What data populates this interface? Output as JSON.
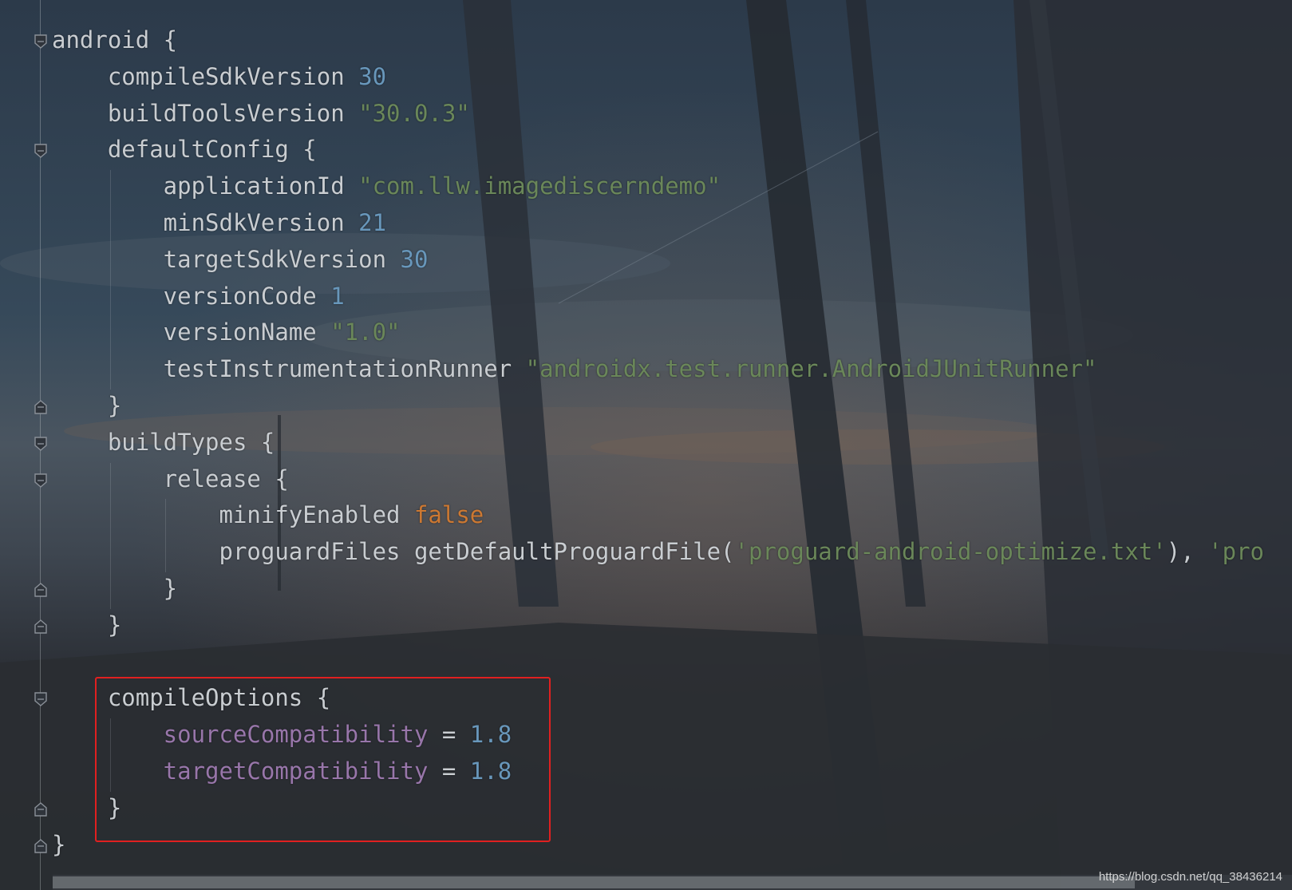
{
  "editor": {
    "language": "groovy",
    "lines": [
      [
        {
          "t": "android {",
          "c": "key"
        }
      ],
      [
        {
          "t": "    compileSdkVersion ",
          "c": "key"
        },
        {
          "t": "30",
          "c": "num"
        }
      ],
      [
        {
          "t": "    buildToolsVersion ",
          "c": "key"
        },
        {
          "t": "\"30.0.3\"",
          "c": "str"
        }
      ],
      [
        {
          "t": "    defaultConfig {",
          "c": "key"
        }
      ],
      [
        {
          "t": "        applicationId ",
          "c": "key"
        },
        {
          "t": "\"com.llw.imagediscerndemo\"",
          "c": "str"
        }
      ],
      [
        {
          "t": "        minSdkVersion ",
          "c": "key"
        },
        {
          "t": "21",
          "c": "num"
        }
      ],
      [
        {
          "t": "        targetSdkVersion ",
          "c": "key"
        },
        {
          "t": "30",
          "c": "num"
        }
      ],
      [
        {
          "t": "        versionCode ",
          "c": "key"
        },
        {
          "t": "1",
          "c": "num"
        }
      ],
      [
        {
          "t": "        versionName ",
          "c": "key"
        },
        {
          "t": "\"1.0\"",
          "c": "str"
        }
      ],
      [
        {
          "t": "        testInstrumentationRunner ",
          "c": "key"
        },
        {
          "t": "\"androidx.test.runner.AndroidJUnitRunner\"",
          "c": "str"
        }
      ],
      [
        {
          "t": "    }",
          "c": "key"
        }
      ],
      [
        {
          "t": "    buildTypes {",
          "c": "key"
        }
      ],
      [
        {
          "t": "        release {",
          "c": "key"
        }
      ],
      [
        {
          "t": "            minifyEnabled ",
          "c": "key"
        },
        {
          "t": "false",
          "c": "bool"
        }
      ],
      [
        {
          "t": "            proguardFiles getDefaultProguardFile(",
          "c": "key"
        },
        {
          "t": "'proguard-android-optimize.txt'",
          "c": "str"
        },
        {
          "t": "), ",
          "c": "key"
        },
        {
          "t": "'pro",
          "c": "str"
        }
      ],
      [
        {
          "t": "        }",
          "c": "key"
        }
      ],
      [
        {
          "t": "    }",
          "c": "key"
        }
      ],
      [],
      [
        {
          "t": "    compileOptions {",
          "c": "key"
        }
      ],
      [
        {
          "t": "        sourceCompatibility",
          "c": "prop"
        },
        {
          "t": " = ",
          "c": "key"
        },
        {
          "t": "1.8",
          "c": "num"
        }
      ],
      [
        {
          "t": "        targetCompatibility",
          "c": "prop"
        },
        {
          "t": " = ",
          "c": "key"
        },
        {
          "t": "1.8",
          "c": "num"
        }
      ],
      [
        {
          "t": "    }",
          "c": "key"
        }
      ],
      [
        {
          "t": "}",
          "c": "key"
        }
      ]
    ],
    "fold_markers": [
      {
        "line": 0,
        "kind": "open"
      },
      {
        "line": 3,
        "kind": "open"
      },
      {
        "line": 10,
        "kind": "close"
      },
      {
        "line": 11,
        "kind": "open"
      },
      {
        "line": 12,
        "kind": "open"
      },
      {
        "line": 15,
        "kind": "close"
      },
      {
        "line": 16,
        "kind": "close"
      },
      {
        "line": 18,
        "kind": "open"
      },
      {
        "line": 21,
        "kind": "close"
      },
      {
        "line": 22,
        "kind": "close"
      }
    ],
    "colors": {
      "keyword": "#c9cdd1",
      "number": "#6897bb",
      "string": "#6a8759",
      "boolean": "#cc7832",
      "property": "#9876aa",
      "highlight_border": "#e02020"
    }
  },
  "watermark": "https://blog.csdn.net/qq_38436214"
}
